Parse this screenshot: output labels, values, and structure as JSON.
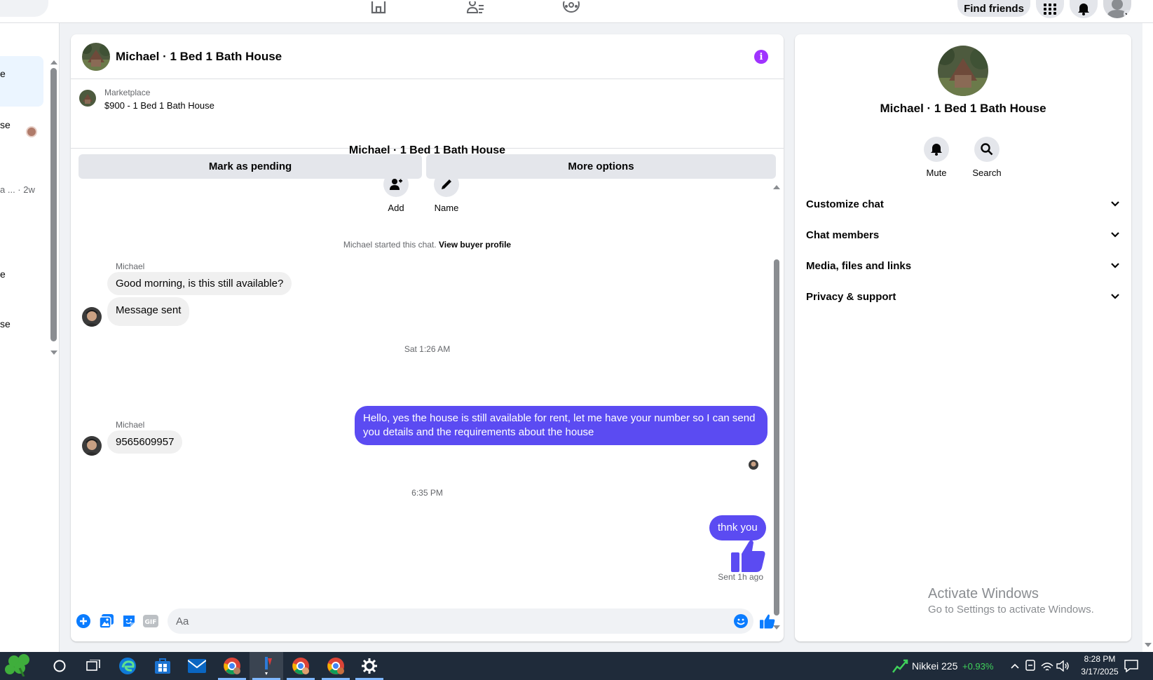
{
  "topbar": {
    "find_friends": "Find friends"
  },
  "left_pane": {
    "fragments": [
      "e",
      "se",
      "a ... · 2w",
      "e",
      "se"
    ]
  },
  "chat": {
    "title": "Michael · 1 Bed 1 Bath House",
    "marketplace": {
      "label": "Marketplace",
      "listing": "$900 - 1 Bed 1 Bath House",
      "mark_pending": "Mark as pending",
      "more_options": "More options"
    },
    "intro_title": "Michael · 1 Bed 1 Bath House",
    "actions": {
      "add": "Add",
      "name": "Name"
    },
    "system": {
      "text": "Michael started this chat.",
      "link": "View buyer profile"
    },
    "messages": [
      {
        "sender": "Michael",
        "text": "Good morning, is this still available?"
      },
      {
        "text": "Message sent"
      },
      {
        "timestamp": "Sat 1:26 AM"
      },
      {
        "text": "Hello, yes the house is still available for rent, let me have your number so I can send you details and the requirements about the house"
      },
      {
        "sender": "Michael",
        "text": "9565609957"
      },
      {
        "timestamp": "6:35 PM"
      },
      {
        "text": "thnk you"
      }
    ],
    "sent_status": "Sent 1h ago",
    "composer": {
      "placeholder": "Aa"
    }
  },
  "info_panel": {
    "name": "Michael · 1 Bed 1 Bath House",
    "mute": "Mute",
    "search": "Search",
    "rows": [
      "Customize chat",
      "Chat members",
      "Media, files and links",
      "Privacy & support"
    ]
  },
  "watermark": {
    "line1": "Activate Windows",
    "line2": "Go to Settings to activate Windows."
  },
  "taskbar": {
    "ticker_name": "Nikkei 225",
    "ticker_change": "+0.93%",
    "time": "8:28 PM",
    "date": "3/17/2025"
  },
  "colors": {
    "accent": "#5b4bf2",
    "info": "#a033ff",
    "messenger_blue": "#0a7cff"
  }
}
